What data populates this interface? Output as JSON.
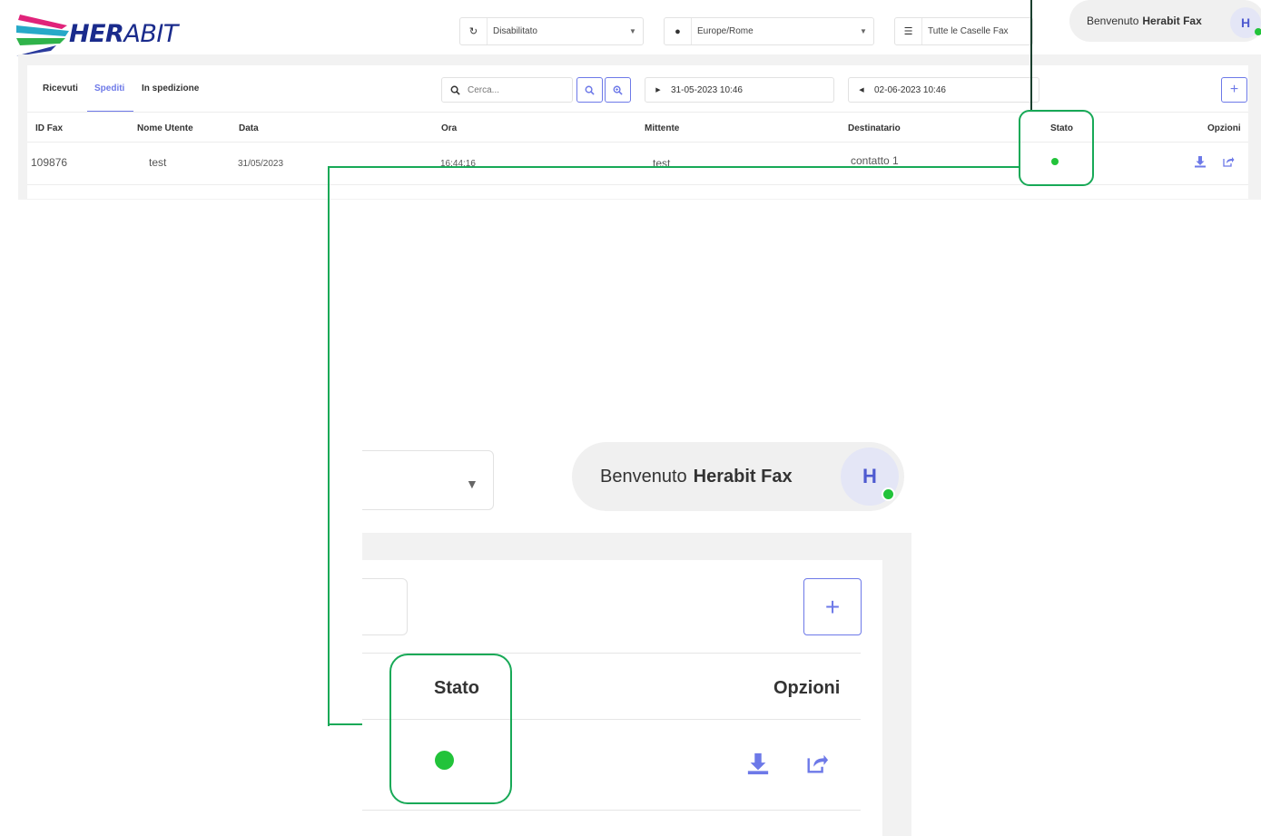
{
  "brand": {
    "logo_bold": "HER",
    "logo_light": "ABIT"
  },
  "header": {
    "sync_select": {
      "icon": "refresh-icon",
      "value": "Disabilitato"
    },
    "timezone_select": {
      "icon": "clock-icon",
      "value": "Europe/Rome"
    },
    "mailbox_select": {
      "icon": "list-icon",
      "value": "Tutte le Caselle Fax"
    },
    "welcome_prefix": "Benvenuto",
    "user_name": "Herabit Fax",
    "avatar_initial": "H"
  },
  "tabs": [
    {
      "label": "Ricevuti"
    },
    {
      "label": "Spediti"
    },
    {
      "label": "In spedizione"
    }
  ],
  "active_tab": "Spediti",
  "toolbar": {
    "search_placeholder": "Cerca...",
    "date_from": "31-05-2023 10:46",
    "date_to": "02-06-2023 10:46"
  },
  "table": {
    "columns": [
      "ID Fax",
      "Nome Utente",
      "Data",
      "Ora",
      "Mittente",
      "Destinatario",
      "Stato",
      "Opzioni"
    ],
    "rows": [
      {
        "id": "109876",
        "user": "test",
        "date": "31/05/2023",
        "time": "16:44:16",
        "sender": "test",
        "recipient": "contatto 1",
        "status_color": "#22c33a"
      }
    ]
  },
  "zoom": {
    "welcome_prefix": "Benvenuto",
    "user_name": "Herabit Fax",
    "avatar_initial": "H",
    "col_status": "Stato",
    "col_options": "Opzioni"
  },
  "colors": {
    "accent": "#6d79e8",
    "highlight": "#18a957",
    "status_ok": "#22c33a"
  }
}
